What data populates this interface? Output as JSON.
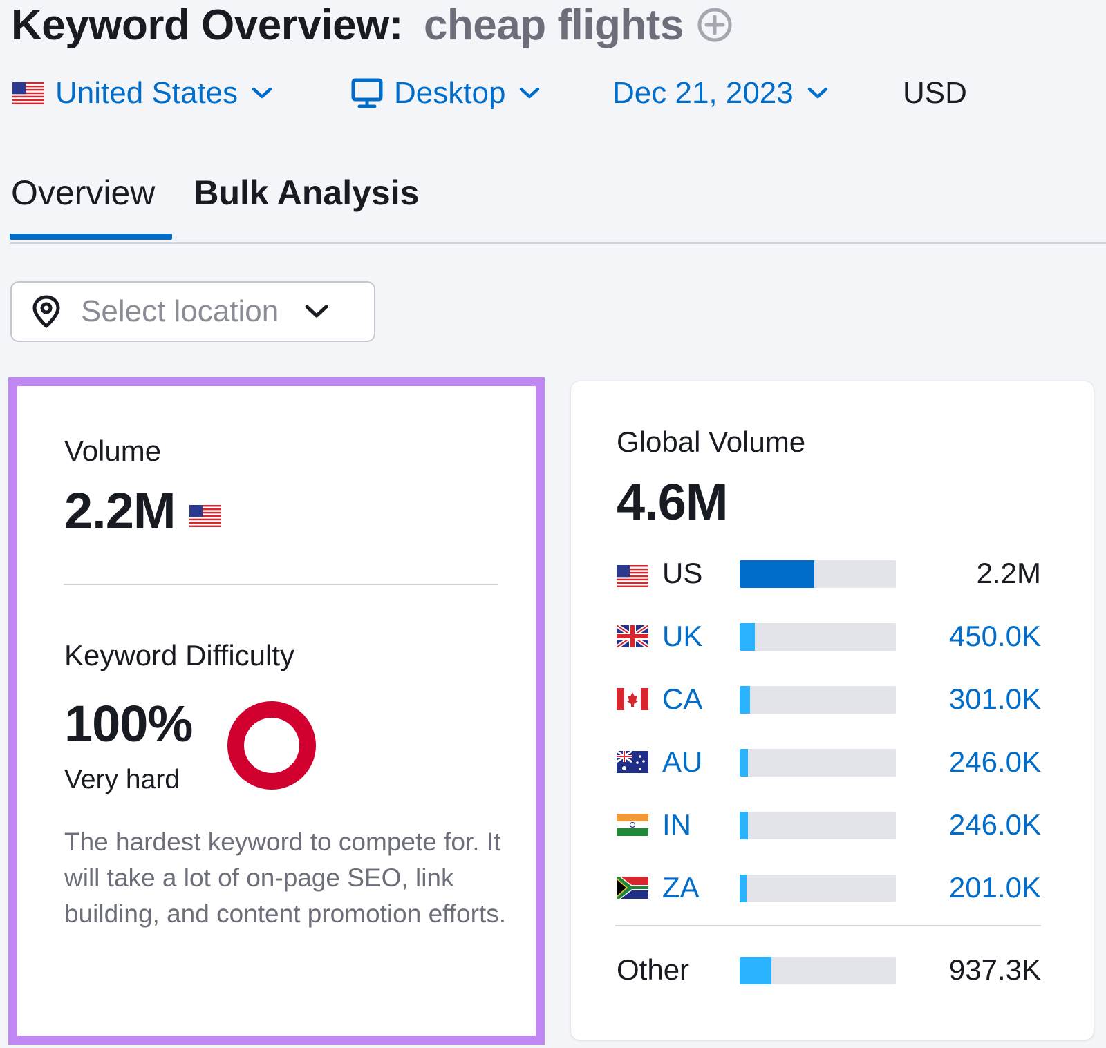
{
  "header": {
    "title": "Keyword Overview:",
    "keyword": "cheap flights",
    "add_icon": "plus-circle-icon"
  },
  "filters": {
    "country": "United States",
    "device": "Desktop",
    "date": "Dec 21, 2023",
    "currency": "USD"
  },
  "tabs": [
    {
      "label": "Overview",
      "active": true
    },
    {
      "label": "Bulk Analysis",
      "active": false
    }
  ],
  "location_select": {
    "placeholder": "Select location",
    "icon": "map-pin-icon"
  },
  "volume_card": {
    "label": "Volume",
    "value": "2.2M",
    "kd_label": "Keyword Difficulty",
    "kd_value": "100%",
    "kd_level": "Very hard",
    "kd_percent": 100,
    "kd_color": "#d1002f",
    "kd_description": "The hardest keyword to compete for. It will take a lot of on-page SEO, link building, and content promotion efforts."
  },
  "global_card": {
    "label": "Global Volume",
    "value": "4.6M",
    "rows": [
      {
        "code": "US",
        "value": "2.2M",
        "share": 0.478,
        "bar_color": "#006dca",
        "link": false
      },
      {
        "code": "UK",
        "value": "450.0K",
        "share": 0.098,
        "bar_color": "#2bb3ff",
        "link": true
      },
      {
        "code": "CA",
        "value": "301.0K",
        "share": 0.065,
        "bar_color": "#2bb3ff",
        "link": true
      },
      {
        "code": "AU",
        "value": "246.0K",
        "share": 0.053,
        "bar_color": "#2bb3ff",
        "link": true
      },
      {
        "code": "IN",
        "value": "246.0K",
        "share": 0.053,
        "bar_color": "#2bb3ff",
        "link": true
      },
      {
        "code": "ZA",
        "value": "201.0K",
        "share": 0.044,
        "bar_color": "#2bb3ff",
        "link": true
      }
    ],
    "other": {
      "label": "Other",
      "value": "937.3K",
      "share": 0.204,
      "bar_color": "#2bb3ff"
    }
  },
  "colors": {
    "link": "#006dca",
    "highlight_border": "#c088f3"
  }
}
